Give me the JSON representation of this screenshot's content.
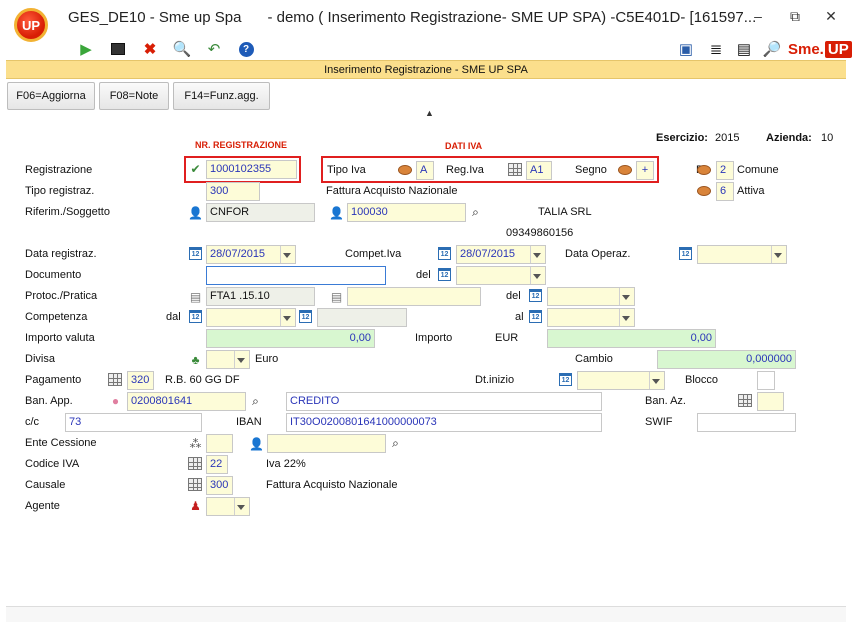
{
  "window": {
    "app_title": "GES_DE10 - Sme up Spa",
    "doc_title": "- demo (  Inserimento Registrazione- SME UP SPA) -C5E401D- [161597...",
    "logo_text": "UP",
    "minimize": "–",
    "restore": "⧉",
    "close": "✕"
  },
  "brand": {
    "sme": "Sme.",
    "up": "UP"
  },
  "form_title": "Inserimento Registrazione -  SME UP SPA",
  "buttons": {
    "f06": "F06=Aggiorna",
    "f08": "F08=Note",
    "f14": "F14=Funz.agg."
  },
  "headers": {
    "nr_registrazione": "NR. REGISTRAZIONE",
    "dati_iva": "DATI IVA"
  },
  "esercizio": {
    "label": "Esercizio:",
    "value": "2015"
  },
  "azienda": {
    "label": "Azienda:",
    "value": "10"
  },
  "fields": {
    "registrazione": {
      "label": "Registrazione",
      "value": "1000102355"
    },
    "tipo_iva": {
      "label": "Tipo Iva",
      "value": "A"
    },
    "reg_iva": {
      "label": "Reg.Iva",
      "value": "A1"
    },
    "segno": {
      "label": "Segno",
      "value": "+"
    },
    "r_label": "R",
    "comune": {
      "value": "2",
      "desc": "Comune"
    },
    "attiva": {
      "value": "6",
      "desc": "Attiva"
    },
    "tipo_registraz": {
      "label": "Tipo registraz.",
      "value": "300",
      "desc": "Fattura Acquisto Nazionale"
    },
    "riferim": {
      "label": "Riferim./Soggetto",
      "value": "CNFOR",
      "soggetto": "100030",
      "desc": "TALIA SRL",
      "piva": "09349860156"
    },
    "data_registraz": {
      "label": "Data registraz.",
      "value": "28/07/2015"
    },
    "compet_iva": {
      "label": "Compet.Iva",
      "value": "28/07/2015"
    },
    "data_operaz": {
      "label": "Data Operaz.",
      "value": ""
    },
    "documento": {
      "label": "Documento",
      "value": "",
      "del_label": "del"
    },
    "protoc": {
      "label": "Protoc./Pratica",
      "value": "FTA1 .15.10",
      "del_label": "del"
    },
    "competenza": {
      "label": "Competenza",
      "dal_label": "dal",
      "al_label": "al"
    },
    "importo_valuta": {
      "label": "Importo valuta",
      "value": "0,00"
    },
    "importo": {
      "label": "Importo",
      "currency": "EUR",
      "value": "0,00"
    },
    "divisa": {
      "label": "Divisa",
      "desc": "Euro"
    },
    "cambio": {
      "label": "Cambio",
      "value": "0,000000"
    },
    "pagamento": {
      "label": "Pagamento",
      "value": "320",
      "desc": "R.B. 60 GG DF"
    },
    "dt_inizio": {
      "label": "Dt.inizio"
    },
    "blocco": {
      "label": "Blocco"
    },
    "ban_app": {
      "label": "Ban. App.",
      "value": "0200801641",
      "desc": "CREDITO"
    },
    "ban_az": {
      "label": "Ban. Az."
    },
    "cc": {
      "label": "c/c",
      "value": "73"
    },
    "iban": {
      "label": "IBAN",
      "value": "IT30O0200801641000000073"
    },
    "swif": {
      "label": "SWIF"
    },
    "ente_cessione": {
      "label": "Ente Cessione"
    },
    "codice_iva": {
      "label": "Codice IVA",
      "value": "22",
      "desc": "Iva 22%"
    },
    "causale": {
      "label": "Causale",
      "value": "300",
      "desc": "Fattura Acquisto Nazionale"
    },
    "agente": {
      "label": "Agente"
    }
  },
  "colors": {
    "accent_red": "#d81e05",
    "form_bar": "#fbdf8c",
    "highlight_box": "#e01f1f",
    "value_blue": "#2a35b8"
  }
}
